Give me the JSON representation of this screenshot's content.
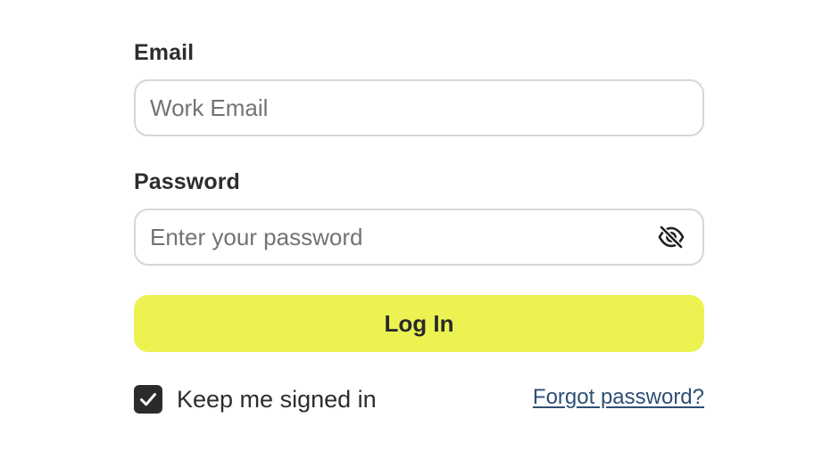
{
  "form": {
    "email": {
      "label": "Email",
      "placeholder": "Work Email",
      "value": ""
    },
    "password": {
      "label": "Password",
      "placeholder": "Enter your password",
      "value": "",
      "toggle_icon": "eye-slash-icon"
    },
    "login_button_label": "Log In",
    "remember_me": {
      "label": "Keep me signed in",
      "checked": true
    },
    "forgot_password_label": "Forgot password?"
  },
  "colors": {
    "accent_button": "#ebf252",
    "checkbox_fill": "#2b2b2b",
    "link": "#2f4f75",
    "field_border": "#d6d6d6"
  }
}
